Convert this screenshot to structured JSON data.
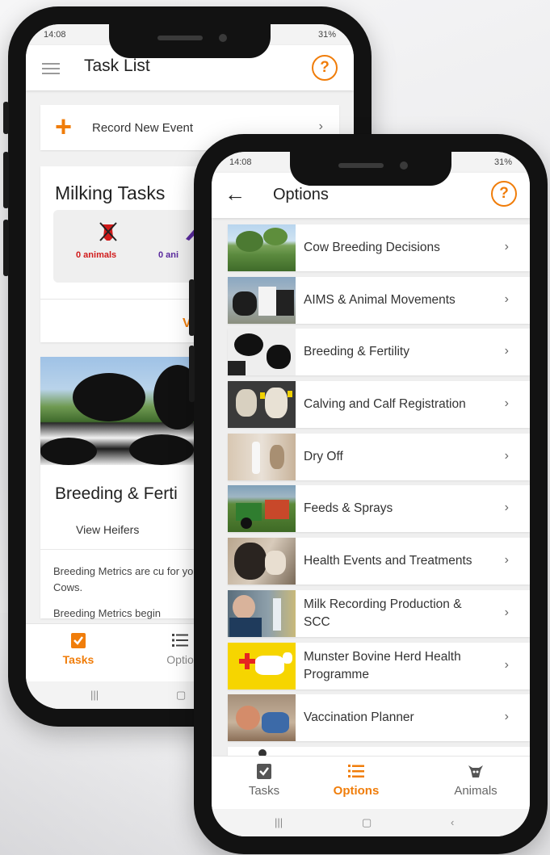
{
  "back_screen": {
    "status": {
      "time": "14:08",
      "battery": "31%"
    },
    "title": "Task List",
    "record_event_label": "Record New Event",
    "milking": {
      "title": "Milking Tasks",
      "items": [
        {
          "label": "0 animals",
          "color": "#d11b1b"
        },
        {
          "label": "0 ani",
          "color": "#5a2a9e"
        }
      ],
      "view_label": "VIE"
    },
    "breeding": {
      "title": "Breeding & Ferti",
      "tab": "View Heifers",
      "text1": "Breeding Metrics are cu for your Cows.",
      "text2": "Breeding Metrics begin"
    },
    "nav": {
      "tasks": "Tasks",
      "options": "Optio"
    }
  },
  "front_screen": {
    "status": {
      "time": "14:08",
      "battery": "31%"
    },
    "title": "Options",
    "options": [
      {
        "label": "Cow Breeding Decisions",
        "thumb": "pasture-trees"
      },
      {
        "label": "AIMS & Animal Movements",
        "thumb": "cows-walking"
      },
      {
        "label": "Breeding & Fertility",
        "thumb": "holstein-cows"
      },
      {
        "label": "Calving and Calf Registration",
        "thumb": "calves-tagged"
      },
      {
        "label": "Dry Off",
        "thumb": "udder"
      },
      {
        "label": "Feeds & Sprays",
        "thumb": "tractor"
      },
      {
        "label": "Health Events and Treatments",
        "thumb": "cow-close"
      },
      {
        "label": "Milk Recording Production & SCC",
        "thumb": "farmer-milk"
      },
      {
        "label": "Munster Bovine Herd Health Programme",
        "thumb": "red-cross-cow"
      },
      {
        "label": "Vaccination Planner",
        "thumb": "calf-vaccine"
      }
    ],
    "nav": {
      "tasks": "Tasks",
      "options": "Options",
      "animals": "Animals"
    }
  },
  "colors": {
    "accent": "#f07d0a"
  }
}
